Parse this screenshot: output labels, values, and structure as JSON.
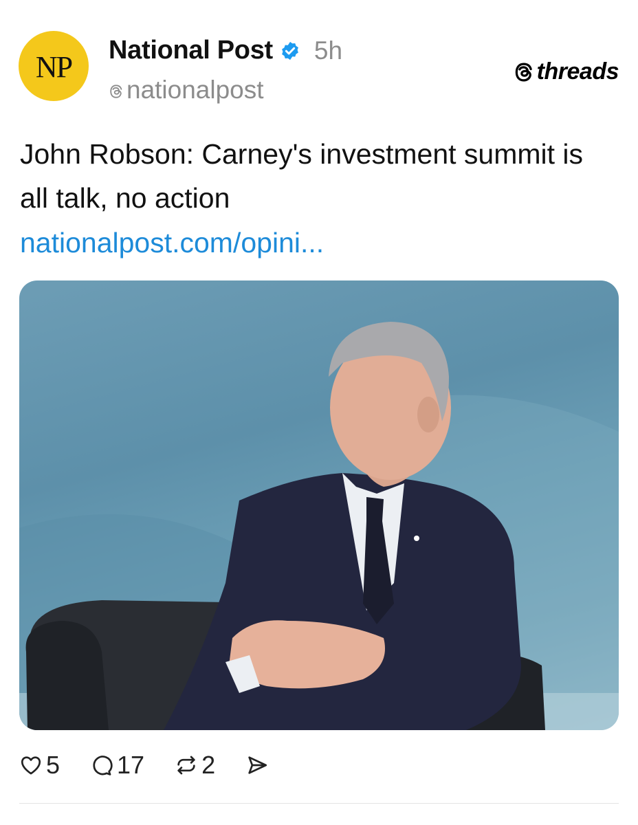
{
  "post": {
    "avatar_text": "NP",
    "author_name": "National Post",
    "time": "5h",
    "handle": "nationalpost",
    "brand": "threads",
    "headline": "John Robson: Carney's investment summit is all talk, no action",
    "link": "nationalpost.com/opini..."
  },
  "actions": {
    "likes": "5",
    "replies": "17",
    "reposts": "2"
  },
  "icons": [
    "verified-badge-icon",
    "threads-logo-icon",
    "heart-icon",
    "reply-icon",
    "repost-icon",
    "share-icon"
  ],
  "colors": {
    "avatar_bg": "#f4c81b",
    "verified": "#1d9bf0",
    "link": "#1d8bd9",
    "muted_text": "#8c8c8c"
  }
}
